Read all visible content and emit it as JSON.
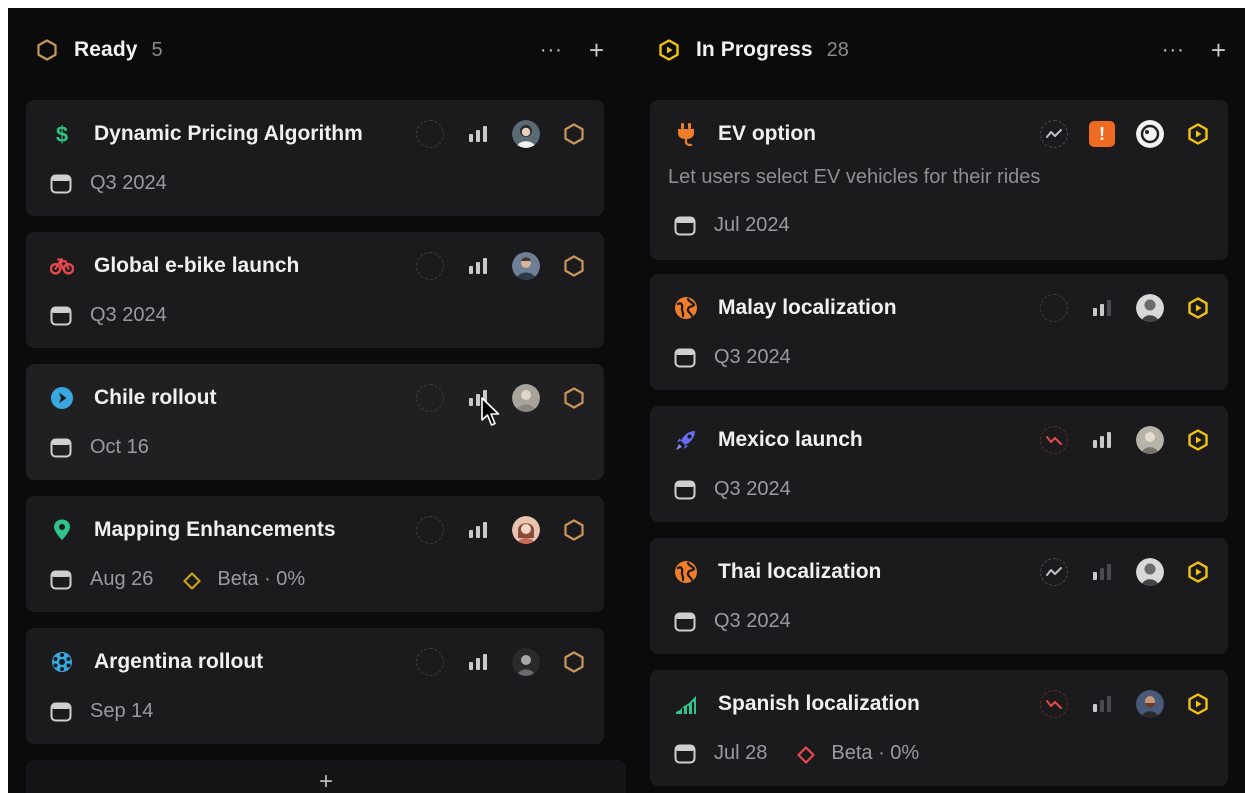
{
  "columns": [
    {
      "title": "Ready",
      "count": "5",
      "status_icon": "hexagon-outline-icon",
      "cards": [
        {
          "title": "Dynamic Pricing Algorithm",
          "icon": "dollar-icon",
          "date": "Q3 2024"
        },
        {
          "title": "Global e-bike launch",
          "icon": "bike-icon",
          "date": "Q3 2024"
        },
        {
          "title": "Chile rollout",
          "icon": "chile-flag-icon",
          "date": "Oct 16"
        },
        {
          "title": "Mapping Enhancements",
          "icon": "map-pin-icon",
          "date": "Aug 26",
          "milestone": "Beta · 0%"
        },
        {
          "title": "Argentina rollout",
          "icon": "globe-network-icon",
          "date": "Sep 14"
        }
      ]
    },
    {
      "title": "In Progress",
      "count": "28",
      "status_icon": "hexagon-play-icon",
      "cards": [
        {
          "title": "EV option",
          "icon": "plug-icon",
          "description": "Let users select EV vehicles for their rides",
          "date": "Jul 2024"
        },
        {
          "title": "Malay localization",
          "icon": "globe-icon",
          "date": "Q3 2024"
        },
        {
          "title": "Mexico launch",
          "icon": "rocket-icon",
          "date": "Q3 2024"
        },
        {
          "title": "Thai localization",
          "icon": "globe-icon",
          "date": "Q3 2024"
        },
        {
          "title": "Spanish localization",
          "icon": "chart-growth-icon",
          "date": "Jul 28",
          "milestone": "Beta · 0%"
        }
      ]
    }
  ],
  "actions": {
    "more": "···",
    "add": "+"
  },
  "colors": {
    "background": "#0b0b0c",
    "card": "#1b1b1e",
    "ready_hex": "#c9965a",
    "in_progress_hex": "#f2c40f",
    "dollar": "#2ec27e",
    "bike": "#e5484d",
    "chile": "#3aa8e0",
    "pin": "#30c48d",
    "argentina": "#3aa8e0",
    "plug": "#f07d2a",
    "globe": "#f07d2a",
    "rocket": "#6a6cf0",
    "chart": "#30c48d",
    "urgent": "#f06b22"
  }
}
